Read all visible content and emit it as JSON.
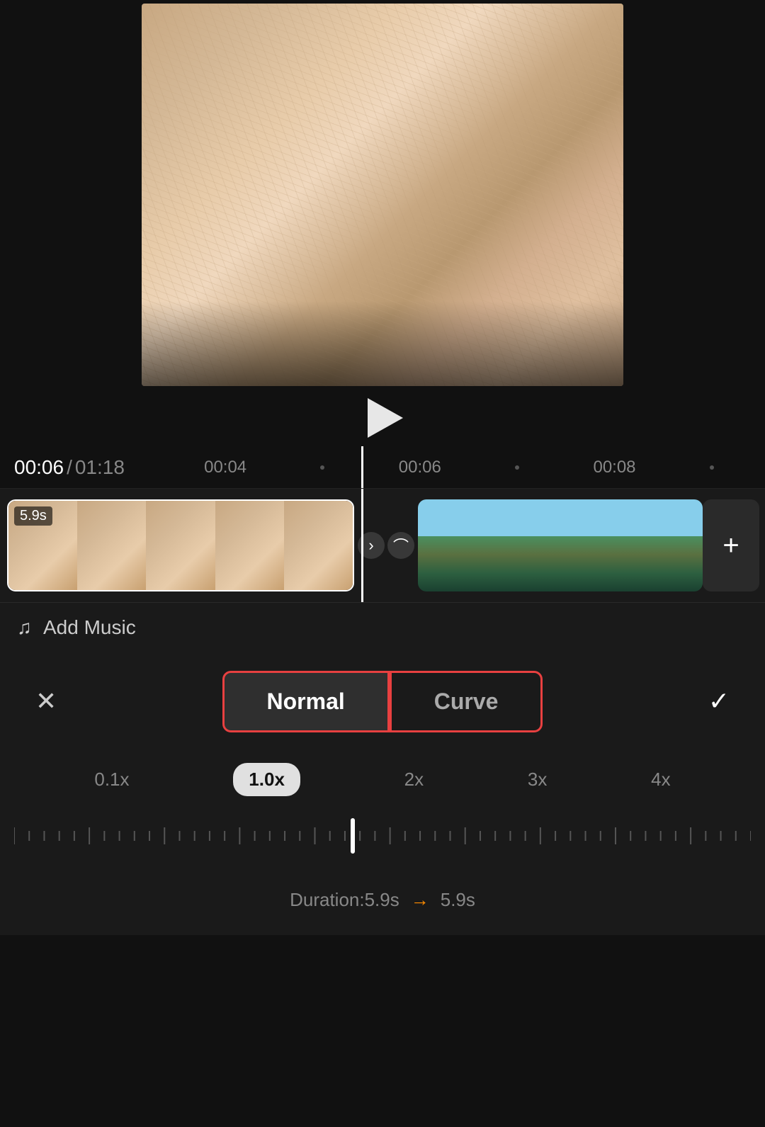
{
  "video": {
    "current_time": "00:06",
    "total_time": "01:18",
    "clip_duration": "5.9s"
  },
  "timeline": {
    "tick1": "00:04",
    "tick2": "00:06",
    "tick3": "00:08"
  },
  "controls": {
    "cancel_icon": "✕",
    "confirm_icon": "✓",
    "add_music_label": "Add Music",
    "normal_label": "Normal",
    "curve_label": "Curve"
  },
  "speed": {
    "val_01x": "0.1x",
    "val_1x": "1.0x",
    "val_2x": "2x",
    "val_3x": "3x",
    "val_4x": "4x"
  },
  "duration": {
    "label": "Duration:5.9s",
    "arrow": "→",
    "after": "5.9s"
  },
  "transition": {
    "btn1": "›",
    "btn2": "⌒"
  }
}
